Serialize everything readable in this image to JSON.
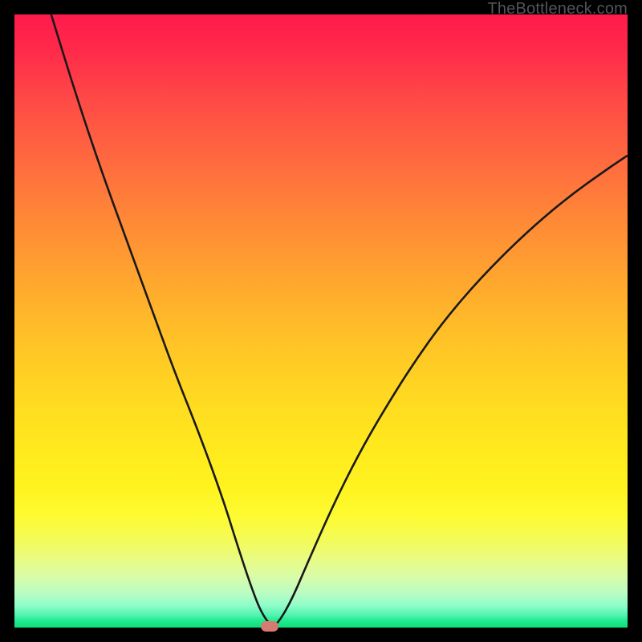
{
  "watermark": "TheBottleneck.com",
  "colors": {
    "frame": "#000000",
    "curve_stroke": "#191919",
    "marker_fill": "#d57b72"
  },
  "chart_data": {
    "type": "line",
    "title": "",
    "xlabel": "",
    "ylabel": "",
    "xlim": [
      0,
      100
    ],
    "ylim": [
      0,
      100
    ],
    "note": "Axes are implicit (no visible ticks or labels). x is normalized horizontal position across the plot area (0=left,100=right); y is normalized value (0=bottom,100=top). Values estimated from curve geometry.",
    "series": [
      {
        "name": "bottleneck-curve",
        "x": [
          6,
          10,
          14,
          18,
          22,
          26,
          30,
          34,
          36.5,
          38.5,
          40,
          41.5,
          42.5,
          45,
          48,
          52,
          56,
          60,
          65,
          70,
          76,
          83,
          90,
          97,
          100
        ],
        "values": [
          100,
          87,
          75,
          64,
          53,
          42,
          32,
          21,
          13,
          7,
          3,
          0.6,
          0,
          4,
          11,
          20,
          28,
          35,
          43,
          50,
          57,
          64,
          70,
          75,
          77
        ]
      }
    ],
    "marker": {
      "name": "optimum-point",
      "x": 41.6,
      "y": 0.2,
      "shape": "rounded-rect"
    },
    "background_gradient": {
      "orientation": "vertical",
      "stops": [
        {
          "pos": 0.0,
          "color": "#ff1a4b"
        },
        {
          "pos": 0.35,
          "color": "#ff8a36"
        },
        {
          "pos": 0.62,
          "color": "#ffd821"
        },
        {
          "pos": 0.82,
          "color": "#fdfb32"
        },
        {
          "pos": 0.95,
          "color": "#b8fdc4"
        },
        {
          "pos": 1.0,
          "color": "#0fe07a"
        }
      ]
    }
  }
}
